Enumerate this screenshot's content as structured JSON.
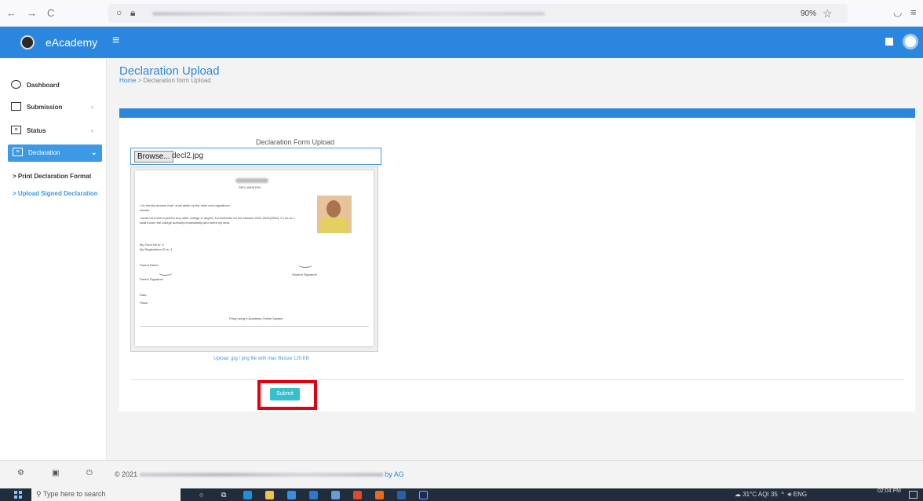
{
  "browser": {
    "back": "←",
    "forward": "→",
    "reload": "C",
    "zoom": "90%"
  },
  "header": {
    "brand": "eAcademy",
    "menu_icon": "hamburger-icon"
  },
  "sidebar": {
    "items": [
      {
        "label": "Dashboard",
        "icon": "dashboard-icon"
      },
      {
        "label": "Submission",
        "icon": "id-card-icon"
      },
      {
        "label": "Status",
        "icon": "list-icon"
      },
      {
        "label": "Declaration",
        "icon": "list-icon"
      }
    ],
    "sub_items": [
      {
        "label": "> Print Declaration Format"
      },
      {
        "label": "> Upload Signed Declaration"
      }
    ]
  },
  "page": {
    "title": "Declaration Upload",
    "breadcrumb_home": "Home",
    "breadcrumb_sep": ">",
    "breadcrumb_current": "Declaration form Upload"
  },
  "form": {
    "label": "Declaration Form Upload",
    "browse_label": "Browse...",
    "file_name": "decl2.jpg",
    "hint": "Upload .jpg / png file with max filesize 120 KB",
    "submit_label": "Submit"
  },
  "document": {
    "heading": "DECLARATION",
    "para1": "I do hereby declare that I shall abide by the rules and regulations",
    "para1b": "Assam.",
    "para2": "I shall not enroll myself in any other college in degree 1st semester for the session 2021-2022(ODD). If I do so, I",
    "para2b": "shall inform the college authority immediately and forfeit my seat.",
    "form_no": "My Form No is: 3",
    "reg_id": "My Registration ID is: 3",
    "parent_name": "Parent Name:",
    "parent_sig": "Parent Signature",
    "student_sig": "Student Signature",
    "date": "Date:",
    "place": "Place:",
    "footer": "Pring using e-Academy Online System"
  },
  "footer": {
    "copyright_prefix": "© 2021",
    "credit": "by AG"
  },
  "taskbar": {
    "search_placeholder": "Type here to search",
    "weather": "31°C AQI 35",
    "lang": "ENG",
    "time": "02:04 PM"
  }
}
